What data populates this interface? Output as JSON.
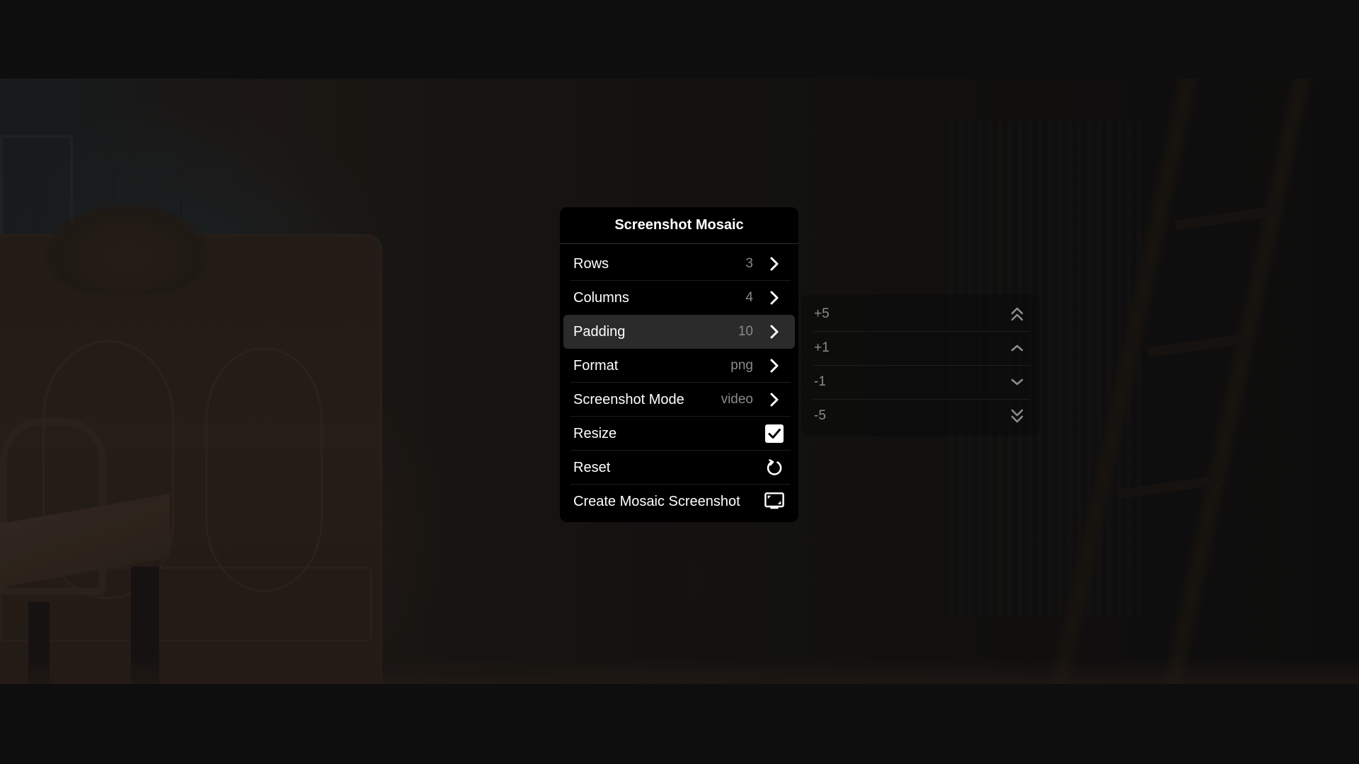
{
  "menu": {
    "title": "Screenshot Mosaic",
    "items": [
      {
        "label": "Rows",
        "value": "3",
        "icon": "chevron-right-icon"
      },
      {
        "label": "Columns",
        "value": "4",
        "icon": "chevron-right-icon"
      },
      {
        "label": "Padding",
        "value": "10",
        "icon": "chevron-right-icon",
        "active": true
      },
      {
        "label": "Format",
        "value": "png",
        "icon": "chevron-right-icon"
      },
      {
        "label": "Screenshot Mode",
        "value": "video",
        "icon": "chevron-right-icon"
      },
      {
        "label": "Resize",
        "checked": true,
        "icon": "checkbox-checked-icon"
      },
      {
        "label": "Reset",
        "icon": "reset-icon"
      },
      {
        "label": "Create Mosaic Screenshot",
        "icon": "screenshot-monitor-icon"
      }
    ]
  },
  "submenu": {
    "parent": "Padding",
    "items": [
      {
        "label": "+5",
        "icon": "double-chevron-up-icon"
      },
      {
        "label": "+1",
        "icon": "chevron-up-icon"
      },
      {
        "label": "-1",
        "icon": "chevron-down-icon"
      },
      {
        "label": "-5",
        "icon": "double-chevron-down-icon"
      }
    ]
  },
  "colors": {
    "menu_bg": "#000000",
    "active_row_bg": "#2b2b2b",
    "value_text": "#8a8a8a",
    "submenu_text": "#8c8c8c",
    "letterbox": "#0e0e0f"
  }
}
